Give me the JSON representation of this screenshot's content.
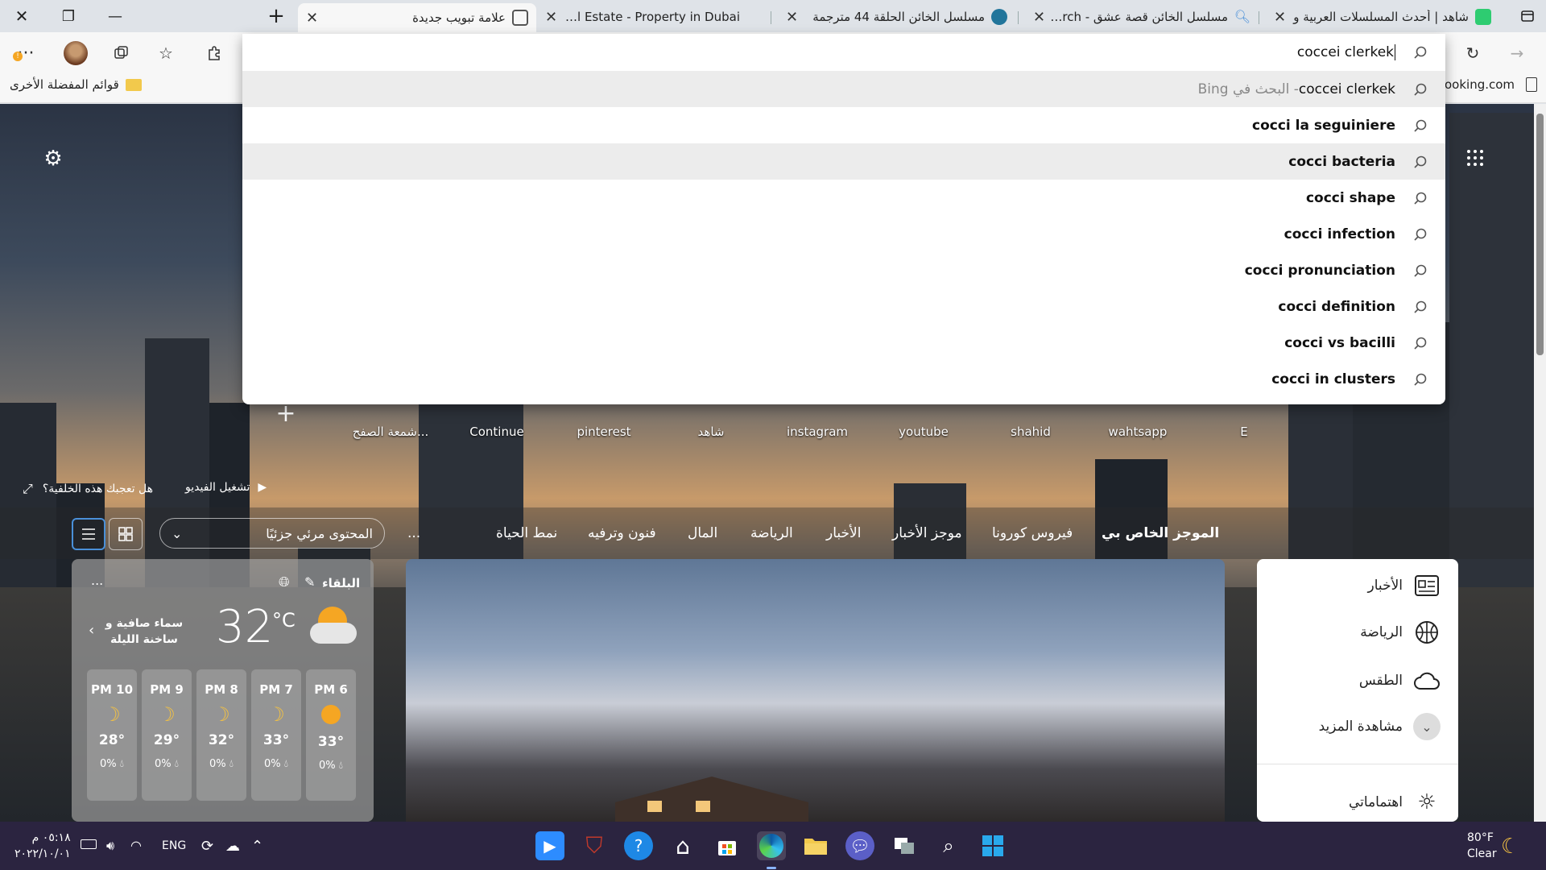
{
  "tabs": [
    {
      "title": "شاهد | أحدث المسلسلات العربية و",
      "color": "#2ecc71"
    },
    {
      "title": "مسلسل الخائن قصة عشق - Search",
      "color": "#4a90d9"
    },
    {
      "title": "مسلسل الخائن الحلقة 44 مترجمة",
      "color": "#21759b"
    },
    {
      "title": "Real Estate - Property in Dubai",
      "color": "#dfe3e8"
    },
    {
      "title": "علامة تبويب جديدة",
      "color": "#555"
    }
  ],
  "address": {
    "value": "coccei clerkek"
  },
  "suggestions": [
    {
      "text": "coccei clerkek",
      "suffix": " - البحث في Bing",
      "bold": false,
      "highlight": true
    },
    {
      "text": "cocci la seguiniere",
      "suffix": "",
      "bold": true,
      "highlight": false
    },
    {
      "text": "cocci bacteria",
      "suffix": "",
      "bold": true,
      "highlight": true
    },
    {
      "text": "cocci shape",
      "suffix": "",
      "bold": true,
      "highlight": false
    },
    {
      "text": "cocci infection",
      "suffix": "",
      "bold": true,
      "highlight": false
    },
    {
      "text": "cocci pronunciation",
      "suffix": "",
      "bold": true,
      "highlight": false
    },
    {
      "text": "cocci definition",
      "suffix": "",
      "bold": true,
      "highlight": false
    },
    {
      "text": "cocci vs bacilli",
      "suffix": "",
      "bold": true,
      "highlight": false
    },
    {
      "text": "cocci in clusters",
      "suffix": "",
      "bold": true,
      "highlight": false
    }
  ],
  "bookmarks": {
    "other_favorites": "قوائم المفضلة الأخرى",
    "right_item": "ooking.com"
  },
  "quick_links": [
    "E",
    "wahtsapp",
    "shahid",
    "youtube",
    "instagram",
    "شاهد",
    "pinterest",
    "Continue",
    "شمعة الصفح..."
  ],
  "background": {
    "like_prompt": "هل تعجبك هذه الخلفية؟",
    "play_video": "تشغيل الفيديو"
  },
  "nav": {
    "items": [
      "الموجز الخاص بي",
      "فيروس كورونا",
      "موجز الأخبار",
      "الأخبار",
      "الرياضة",
      "المال",
      "فنون وترفيه",
      "نمط الحياة"
    ],
    "more": "...",
    "visibility": "المحتوى مرئي جزئيًا"
  },
  "weather": {
    "location": "البلقاء",
    "temp": "32",
    "unit": "°C",
    "desc": "سماء صافية و ساخنة الليلة",
    "more": "...",
    "hours": [
      {
        "time": "PM 6",
        "icon": "sun",
        "temp": "33°",
        "precip": "0%"
      },
      {
        "time": "PM 7",
        "icon": "moon",
        "temp": "33°",
        "precip": "0%"
      },
      {
        "time": "PM 8",
        "icon": "moon",
        "temp": "32°",
        "precip": "0%"
      },
      {
        "time": "PM 9",
        "icon": "moon",
        "temp": "29°",
        "precip": "0%"
      },
      {
        "time": "PM 10",
        "icon": "moon",
        "temp": "28°",
        "precip": "0%"
      }
    ]
  },
  "right_panel": {
    "items": [
      "الأخبار",
      "الرياضة",
      "الطقس",
      "مشاهدة المزيد"
    ],
    "interests": "اهتماماتي"
  },
  "taskbar": {
    "weather_temp": "80°F",
    "weather_desc": "Clear",
    "lang": "ENG",
    "time": "٠٥:١٨ م",
    "date": "٢٠٢٢/١٠/٠١"
  }
}
